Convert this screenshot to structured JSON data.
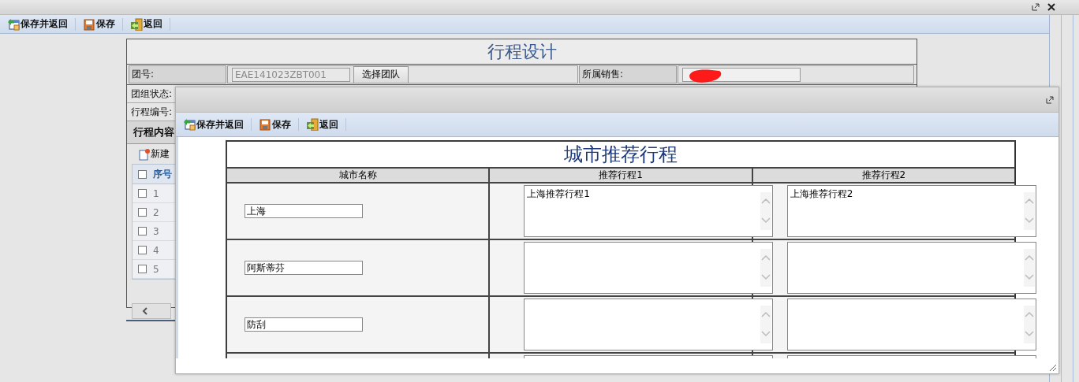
{
  "top_toolbar": {
    "buttons": [
      {
        "label": "保存并返回"
      },
      {
        "label": "保存"
      },
      {
        "label": "返回"
      }
    ]
  },
  "trip_form": {
    "title": "行程设计",
    "fields": [
      {
        "label": "团号:",
        "value": "EAE141023ZBT001",
        "disabled": true,
        "button": "选择团队"
      },
      {
        "label": "所属销售:",
        "redacted": true,
        "disabled": false
      }
    ],
    "labels": [
      "团组状态:",
      "行程编号:"
    ],
    "section": "行程内容",
    "new_button": "新建",
    "grid": {
      "columns": [
        "序号"
      ],
      "all_checked": false,
      "rows": [
        {
          "number": "1",
          "checked": false
        },
        {
          "number": "2",
          "checked": false
        },
        {
          "number": "3",
          "checked": false
        },
        {
          "number": "4",
          "checked": false
        },
        {
          "number": "5",
          "checked": false
        }
      ]
    }
  },
  "dialog": {
    "toolbar": {
      "buttons": [
        {
          "label": "保存并返回"
        },
        {
          "label": "保存"
        },
        {
          "label": "返回"
        }
      ]
    },
    "table": {
      "title": "城市推荐行程",
      "columns": [
        "城市名称",
        "推荐行程1",
        "推荐行程2"
      ],
      "rows": [
        {
          "city": "上海",
          "plan_1": "上海推荐行程1",
          "plan_2": "上海推荐行程2"
        },
        {
          "city": "阿斯蒂芬"
        },
        {
          "city": "防刮"
        },
        {}
      ]
    }
  }
}
